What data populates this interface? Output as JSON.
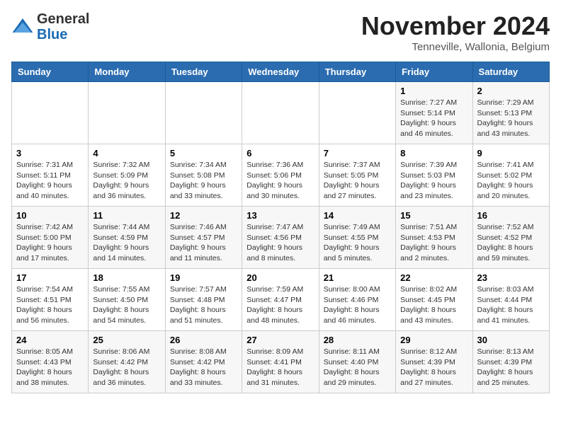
{
  "logo": {
    "general": "General",
    "blue": "Blue"
  },
  "title": "November 2024",
  "location": "Tenneville, Wallonia, Belgium",
  "days_of_week": [
    "Sunday",
    "Monday",
    "Tuesday",
    "Wednesday",
    "Thursday",
    "Friday",
    "Saturday"
  ],
  "weeks": [
    [
      {
        "day": "",
        "info": ""
      },
      {
        "day": "",
        "info": ""
      },
      {
        "day": "",
        "info": ""
      },
      {
        "day": "",
        "info": ""
      },
      {
        "day": "",
        "info": ""
      },
      {
        "day": "1",
        "info": "Sunrise: 7:27 AM\nSunset: 5:14 PM\nDaylight: 9 hours and 46 minutes."
      },
      {
        "day": "2",
        "info": "Sunrise: 7:29 AM\nSunset: 5:13 PM\nDaylight: 9 hours and 43 minutes."
      }
    ],
    [
      {
        "day": "3",
        "info": "Sunrise: 7:31 AM\nSunset: 5:11 PM\nDaylight: 9 hours and 40 minutes."
      },
      {
        "day": "4",
        "info": "Sunrise: 7:32 AM\nSunset: 5:09 PM\nDaylight: 9 hours and 36 minutes."
      },
      {
        "day": "5",
        "info": "Sunrise: 7:34 AM\nSunset: 5:08 PM\nDaylight: 9 hours and 33 minutes."
      },
      {
        "day": "6",
        "info": "Sunrise: 7:36 AM\nSunset: 5:06 PM\nDaylight: 9 hours and 30 minutes."
      },
      {
        "day": "7",
        "info": "Sunrise: 7:37 AM\nSunset: 5:05 PM\nDaylight: 9 hours and 27 minutes."
      },
      {
        "day": "8",
        "info": "Sunrise: 7:39 AM\nSunset: 5:03 PM\nDaylight: 9 hours and 23 minutes."
      },
      {
        "day": "9",
        "info": "Sunrise: 7:41 AM\nSunset: 5:02 PM\nDaylight: 9 hours and 20 minutes."
      }
    ],
    [
      {
        "day": "10",
        "info": "Sunrise: 7:42 AM\nSunset: 5:00 PM\nDaylight: 9 hours and 17 minutes."
      },
      {
        "day": "11",
        "info": "Sunrise: 7:44 AM\nSunset: 4:59 PM\nDaylight: 9 hours and 14 minutes."
      },
      {
        "day": "12",
        "info": "Sunrise: 7:46 AM\nSunset: 4:57 PM\nDaylight: 9 hours and 11 minutes."
      },
      {
        "day": "13",
        "info": "Sunrise: 7:47 AM\nSunset: 4:56 PM\nDaylight: 9 hours and 8 minutes."
      },
      {
        "day": "14",
        "info": "Sunrise: 7:49 AM\nSunset: 4:55 PM\nDaylight: 9 hours and 5 minutes."
      },
      {
        "day": "15",
        "info": "Sunrise: 7:51 AM\nSunset: 4:53 PM\nDaylight: 9 hours and 2 minutes."
      },
      {
        "day": "16",
        "info": "Sunrise: 7:52 AM\nSunset: 4:52 PM\nDaylight: 8 hours and 59 minutes."
      }
    ],
    [
      {
        "day": "17",
        "info": "Sunrise: 7:54 AM\nSunset: 4:51 PM\nDaylight: 8 hours and 56 minutes."
      },
      {
        "day": "18",
        "info": "Sunrise: 7:55 AM\nSunset: 4:50 PM\nDaylight: 8 hours and 54 minutes."
      },
      {
        "day": "19",
        "info": "Sunrise: 7:57 AM\nSunset: 4:48 PM\nDaylight: 8 hours and 51 minutes."
      },
      {
        "day": "20",
        "info": "Sunrise: 7:59 AM\nSunset: 4:47 PM\nDaylight: 8 hours and 48 minutes."
      },
      {
        "day": "21",
        "info": "Sunrise: 8:00 AM\nSunset: 4:46 PM\nDaylight: 8 hours and 46 minutes."
      },
      {
        "day": "22",
        "info": "Sunrise: 8:02 AM\nSunset: 4:45 PM\nDaylight: 8 hours and 43 minutes."
      },
      {
        "day": "23",
        "info": "Sunrise: 8:03 AM\nSunset: 4:44 PM\nDaylight: 8 hours and 41 minutes."
      }
    ],
    [
      {
        "day": "24",
        "info": "Sunrise: 8:05 AM\nSunset: 4:43 PM\nDaylight: 8 hours and 38 minutes."
      },
      {
        "day": "25",
        "info": "Sunrise: 8:06 AM\nSunset: 4:42 PM\nDaylight: 8 hours and 36 minutes."
      },
      {
        "day": "26",
        "info": "Sunrise: 8:08 AM\nSunset: 4:42 PM\nDaylight: 8 hours and 33 minutes."
      },
      {
        "day": "27",
        "info": "Sunrise: 8:09 AM\nSunset: 4:41 PM\nDaylight: 8 hours and 31 minutes."
      },
      {
        "day": "28",
        "info": "Sunrise: 8:11 AM\nSunset: 4:40 PM\nDaylight: 8 hours and 29 minutes."
      },
      {
        "day": "29",
        "info": "Sunrise: 8:12 AM\nSunset: 4:39 PM\nDaylight: 8 hours and 27 minutes."
      },
      {
        "day": "30",
        "info": "Sunrise: 8:13 AM\nSunset: 4:39 PM\nDaylight: 8 hours and 25 minutes."
      }
    ]
  ]
}
